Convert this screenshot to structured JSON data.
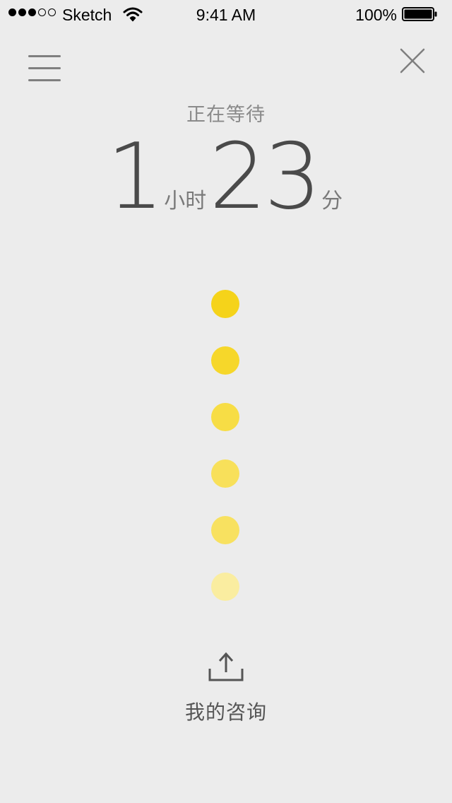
{
  "status_bar": {
    "carrier": "Sketch",
    "time": "9:41 AM",
    "battery_percent": "100%",
    "signal_strength": 3,
    "signal_total": 5
  },
  "nav": {
    "menu_icon": "hamburger-menu-icon",
    "close_icon": "close-icon"
  },
  "waiting": {
    "label": "正在等待",
    "hours": "1",
    "hours_unit": "小时",
    "minutes": "23",
    "minutes_unit": "分"
  },
  "progress_dots": {
    "colors": [
      "#f5d31a",
      "#f6d72a",
      "#f7dd45",
      "#f8e05a",
      "#f8e160",
      "#faeda0"
    ]
  },
  "action": {
    "icon": "share-upload-icon",
    "label": "我的咨询"
  },
  "colors": {
    "background": "#ececec",
    "text_dark": "#4a4a4a",
    "text_muted": "#8a8a8a"
  }
}
